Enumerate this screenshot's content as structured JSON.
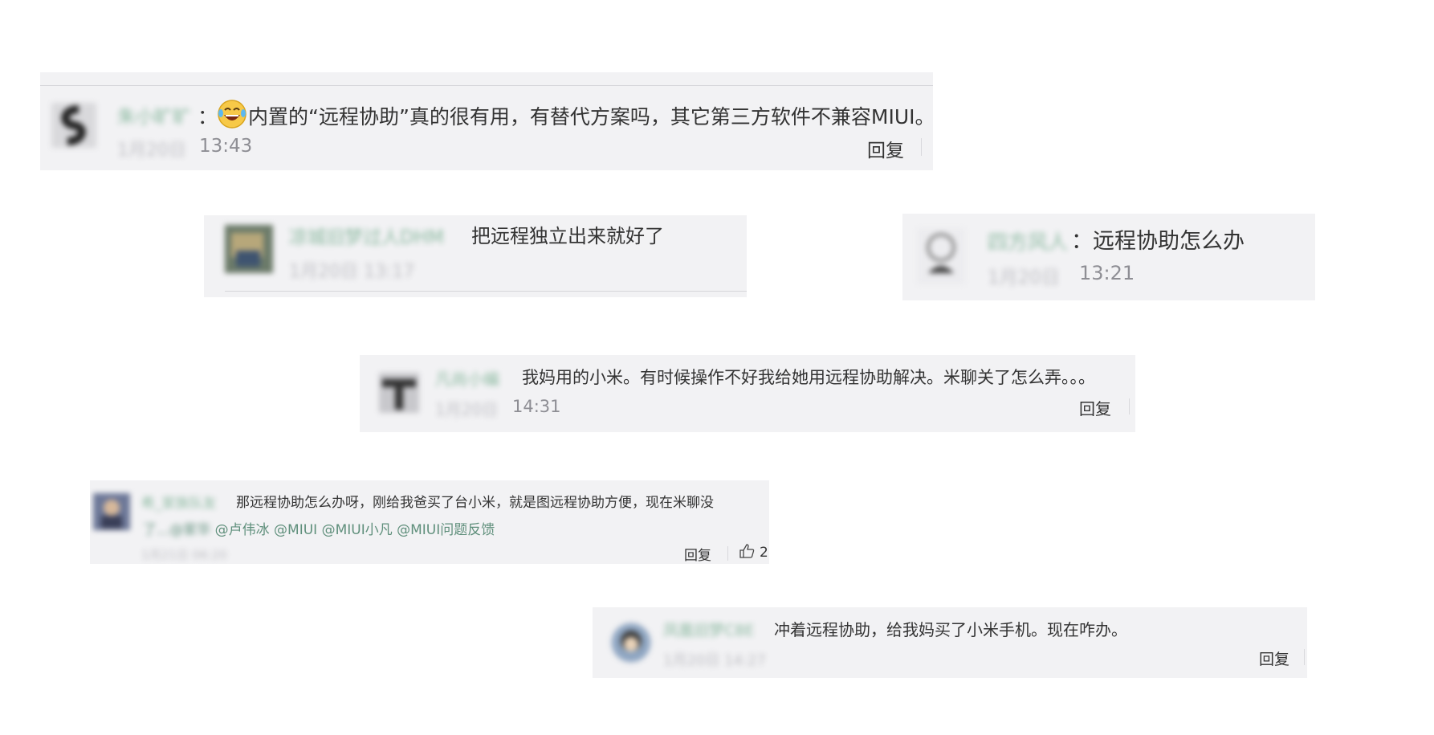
{
  "comments": [
    {
      "username": "朱小旷旷",
      "colon": "：",
      "emoji": "laughing-tears-emoji",
      "text": "内置的“远程协助”真的很有用，有替代方案吗，其它第三方软件不兼容MIUI。",
      "date_blurred": "1月20日",
      "time_visible": "13:43",
      "reply": "回复"
    },
    {
      "username": "凉城旧梦过人DHM",
      "text": "把远程独立出来就好了",
      "timestamp": "1月20日 13:17"
    },
    {
      "username": "四方风人",
      "colon": "：",
      "text": "远程协助怎么办",
      "date_blurred": "1月20日",
      "time_visible": "13:21"
    },
    {
      "username": "凡尚小编",
      "text": "我妈用的小米。有时候操作不好我给她用远程协助解决。米聊关了怎么弄。。。",
      "date_blurred": "1月20日",
      "time_visible": "14:31",
      "reply": "回复"
    },
    {
      "username": "希_家族队友",
      "text": "那远程协助怎么办呀，刚给我爸买了台小米，就是图远程协助方便，现在米聊没",
      "line2_blurred": "了...@家华",
      "mentions": "@卢伟冰 @MIUI @MIUI小凡 @MIUI问题反馈",
      "timestamp": "1月21日 06:20",
      "reply": "回复",
      "likes": "2"
    },
    {
      "username": "凤凰旧梦C8E",
      "text": "冲着远程协助，给我妈买了小米手机。现在咋办。",
      "timestamp": "1月20日 14:27",
      "reply": "回复"
    }
  ]
}
